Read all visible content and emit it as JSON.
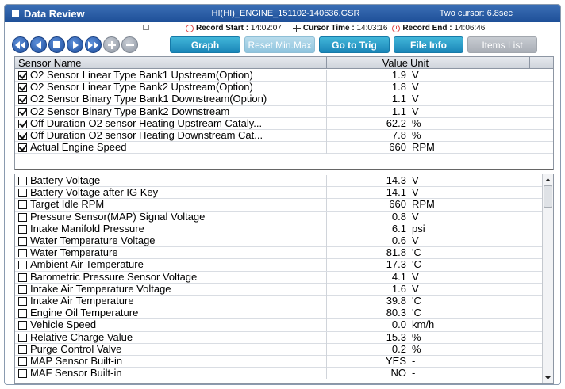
{
  "window": {
    "title": "Data Review",
    "file_name": "HI(HI)_ENGINE_151102-140636.GSR",
    "cursor_info": "Two cursor: 6.8sec"
  },
  "record": {
    "start_label": "Record Start :",
    "start_time": "14:02:07",
    "cursor_label": "Cursor Time :",
    "cursor_time": "14:03:16",
    "end_label": "Record End :",
    "end_time": "14:06:46"
  },
  "toolbar": {
    "graph": "Graph",
    "reset_min_max": "Reset Min.Max",
    "go_to_trig": "Go to Trig",
    "file_info": "File Info",
    "items_list": "Items List"
  },
  "columns": {
    "name": "Sensor Name",
    "value": "Value",
    "unit": "Unit"
  },
  "selected_rows": [
    {
      "name": "O2 Sensor Linear Type Bank1 Upstream(Option)",
      "value": "1.9",
      "unit": "V"
    },
    {
      "name": "O2 Sensor Linear Type Bank2 Upstream(Option)",
      "value": "1.8",
      "unit": "V"
    },
    {
      "name": "O2 Sensor Binary Type Bank1 Downstream(Option)",
      "value": "1.1",
      "unit": "V"
    },
    {
      "name": "O2 Sensor Binary Type Bank2 Downstream",
      "value": "1.1",
      "unit": "V"
    },
    {
      "name": "Off Duration O2 sensor Heating Upstream Cataly...",
      "value": "62.2",
      "unit": "%"
    },
    {
      "name": "Off Duration O2 sensor Heating Downstream Cat...",
      "value": "7.8",
      "unit": "%"
    },
    {
      "name": "Actual Engine Speed",
      "value": "660",
      "unit": "RPM"
    }
  ],
  "all_rows": [
    {
      "name": "Battery Voltage",
      "value": "14.3",
      "unit": "V"
    },
    {
      "name": "Battery Voltage after IG Key",
      "value": "14.1",
      "unit": "V"
    },
    {
      "name": "Target Idle RPM",
      "value": "660",
      "unit": "RPM"
    },
    {
      "name": "Pressure Sensor(MAP) Signal Voltage",
      "value": "0.8",
      "unit": "V"
    },
    {
      "name": "Intake Manifold Pressure",
      "value": "6.1",
      "unit": "psi"
    },
    {
      "name": "Water Temperature Voltage",
      "value": "0.6",
      "unit": "V"
    },
    {
      "name": "Water Temperature",
      "value": "81.8",
      "unit": "'C"
    },
    {
      "name": "Ambient Air Temperature",
      "value": "17.3",
      "unit": "'C"
    },
    {
      "name": "Barometric Pressure Sensor Voltage",
      "value": "4.1",
      "unit": "V"
    },
    {
      "name": "Intake Air Temperature Voltage",
      "value": "1.6",
      "unit": "V"
    },
    {
      "name": "Intake Air Temperature",
      "value": "39.8",
      "unit": "'C"
    },
    {
      "name": "Engine Oil Temperature",
      "value": "80.3",
      "unit": "'C"
    },
    {
      "name": "Vehicle Speed",
      "value": "0.0",
      "unit": "km/h"
    },
    {
      "name": "Relative Charge Value",
      "value": "15.3",
      "unit": "%"
    },
    {
      "name": "Purge Control Valve",
      "value": "0.2",
      "unit": "%"
    },
    {
      "name": "MAP Sensor Built-in",
      "value": "YES",
      "unit": "-"
    },
    {
      "name": "MAF Sensor Built-in",
      "value": "NO",
      "unit": "-"
    }
  ],
  "icons": {
    "first": "skip-to-start-icon",
    "prev": "step-back-icon",
    "stop": "stop-icon",
    "next": "step-forward-icon",
    "last": "skip-to-end-icon",
    "add": "plus-icon",
    "remove": "minus-icon"
  },
  "colors": {
    "title_bar": "#1e4f98",
    "button": "#1a86b8",
    "nav_button": "#1c4c9c"
  }
}
